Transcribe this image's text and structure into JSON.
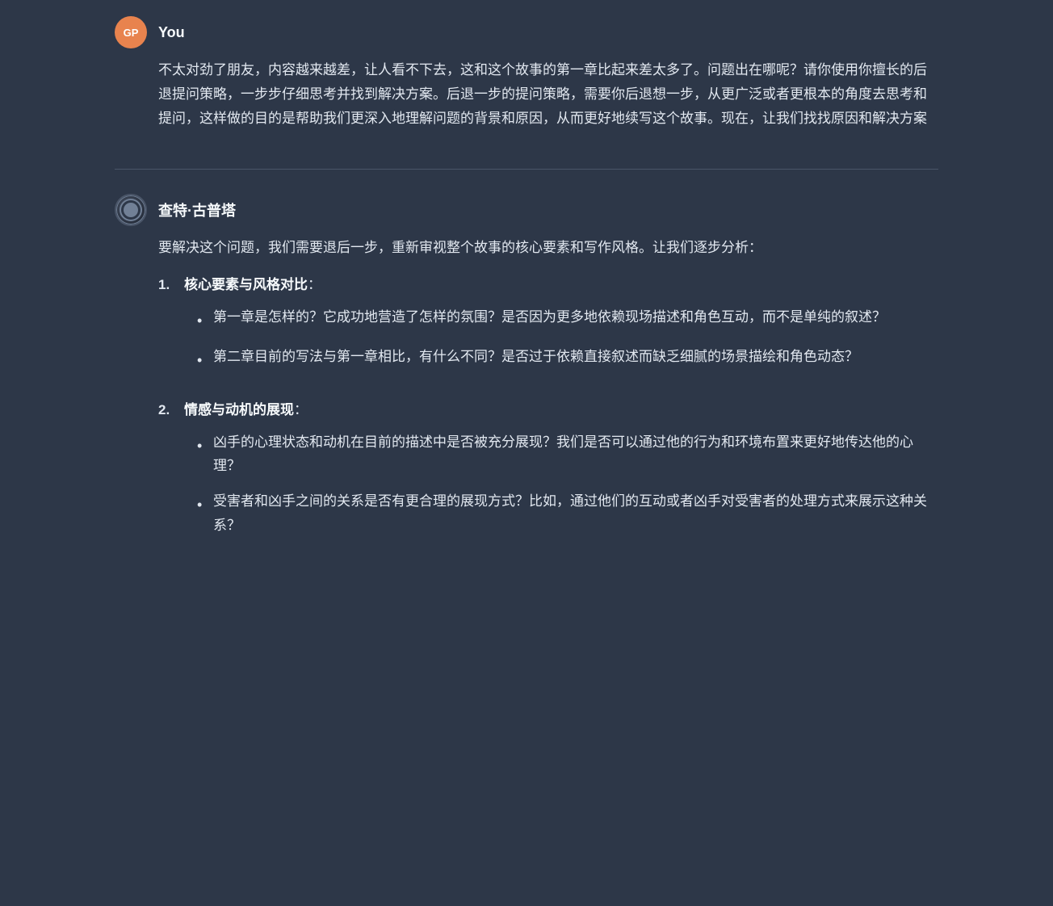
{
  "colors": {
    "background": "#2d3748",
    "text": "#e2e8f0",
    "heading": "#f7fafc",
    "avatar_user_bg": "#e8834e",
    "divider": "#4a5568"
  },
  "user_message": {
    "sender": "You",
    "avatar_initials": "GP",
    "content": "不太对劲了朋友，内容越来越差，让人看不下去，这和这个故事的第一章比起来差太多了。问题出在哪呢？请你使用你擅长的后退提问策略，一步步仔细思考并找到解决方案。后退一步的提问策略，需要你后退想一步，从更广泛或者更根本的角度去思考和提问，这样做的目的是帮助我们更深入地理解问题的背景和原因，从而更好地续写这个故事。现在，让我们找找原因和解决方案"
  },
  "ai_message": {
    "sender": "查特·古普塔",
    "intro": "要解决这个问题，我们需要退后一步，重新审视整个故事的核心要素和写作风格。让我们逐步分析：",
    "sections": [
      {
        "number": "1.",
        "title": "核心要素与风格对比",
        "bullets": [
          "第一章是怎样的？它成功地营造了怎样的氛围？是否因为更多地依赖现场描述和角色互动，而不是单纯的叙述？",
          "第二章目前的写法与第一章相比，有什么不同？是否过于依赖直接叙述而缺乏细腻的场景描绘和角色动态？"
        ]
      },
      {
        "number": "2.",
        "title": "情感与动机的展现",
        "bullets": [
          "凶手的心理状态和动机在目前的描述中是否被充分展现？我们是否可以通过他的行为和环境布置来更好地传达他的心理？",
          "受害者和凶手之间的关系是否有更合理的展现方式？比如，通过他们的互动或者凶手对受害者的处理方式来展示这种关系？"
        ]
      }
    ]
  }
}
